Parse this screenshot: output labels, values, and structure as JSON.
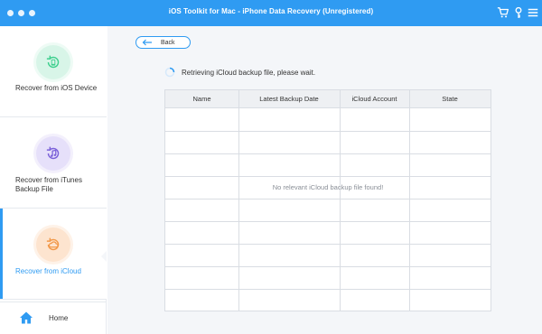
{
  "window": {
    "title": "iOS Toolkit for Mac - iPhone Data Recovery (Unregistered)",
    "traffic_lights": [
      "close",
      "minimize",
      "zoom"
    ],
    "toolbar_icons": [
      "cart-icon",
      "key-icon",
      "menu-icon"
    ],
    "accent_color": "#2f9bf2"
  },
  "sidebar": {
    "items": [
      {
        "label": "Recover from iOS Device",
        "icon": "ios-device-icon",
        "icon_color": "#3ecf8e",
        "active": false
      },
      {
        "label": "Recover from iTunes Backup File",
        "icon": "itunes-icon",
        "icon_color": "#7b61d9",
        "active": false
      },
      {
        "label": "Recover from iCloud",
        "icon": "icloud-icon",
        "icon_color": "#f2994a",
        "active": true
      }
    ],
    "home": {
      "label": "Home",
      "icon": "home-icon"
    }
  },
  "main": {
    "back_label": "Back",
    "status_text": "Retrieving iCloud backup file, please wait.",
    "table": {
      "columns": [
        "Name",
        "Latest Backup Date",
        "iCloud Account",
        "State"
      ],
      "rows": [],
      "empty_message": "No relevant iCloud backup file found!"
    }
  }
}
